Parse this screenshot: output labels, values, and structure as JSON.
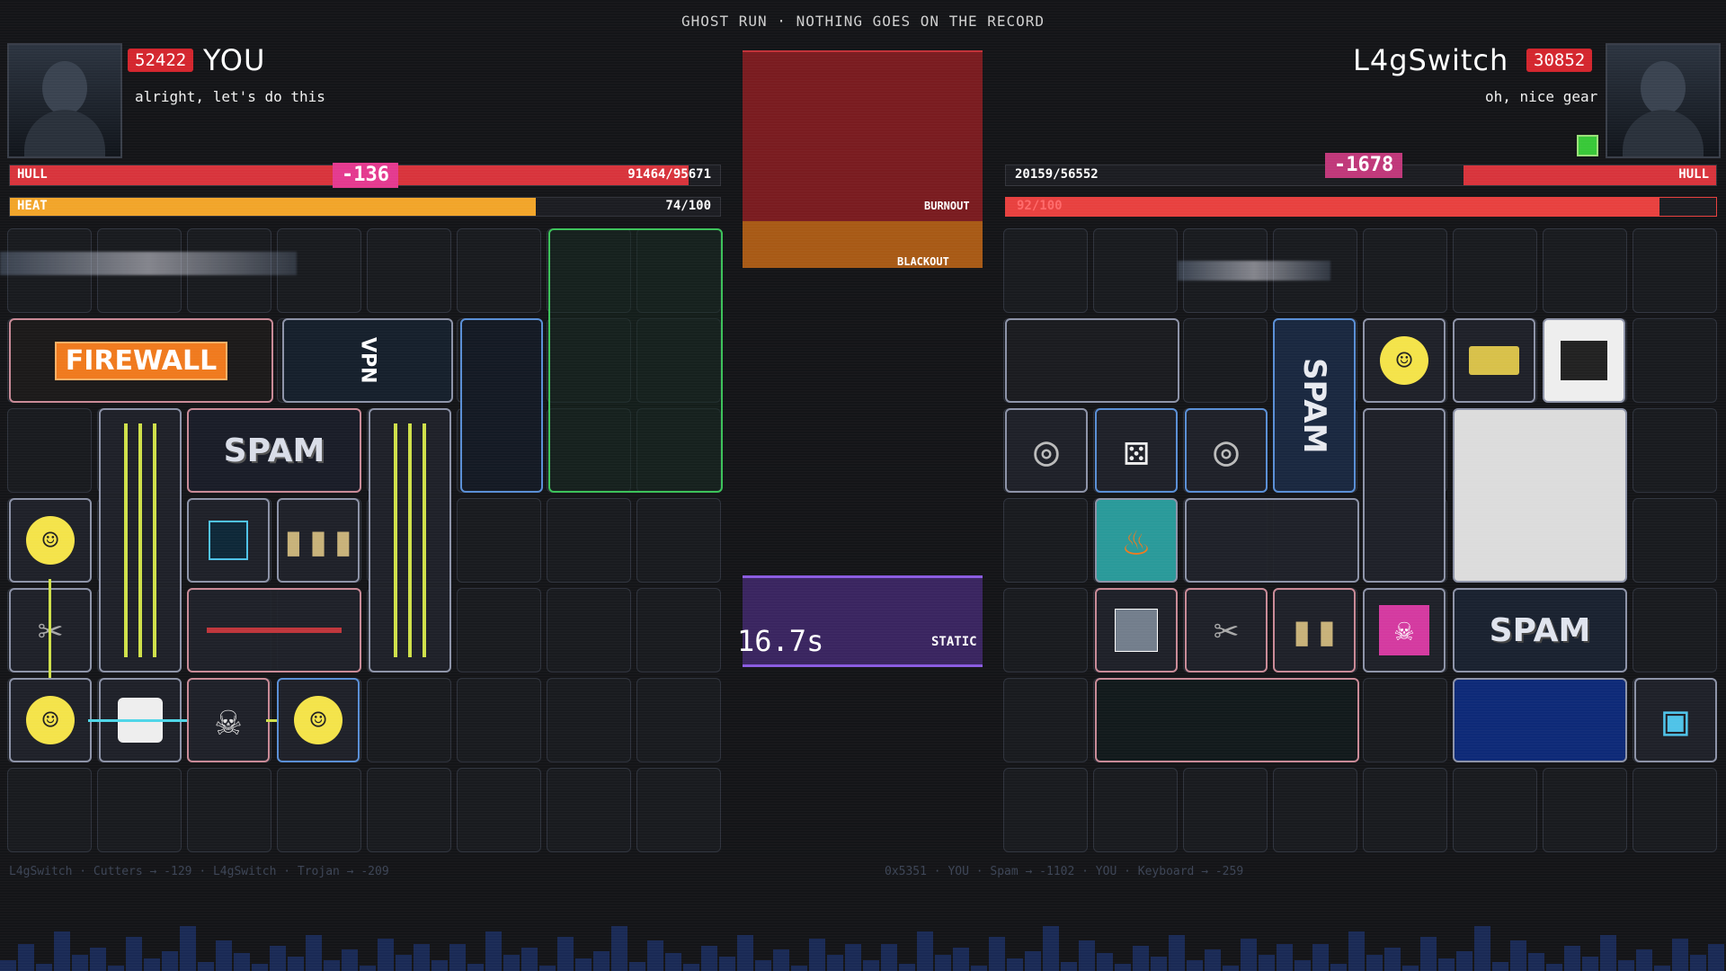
{
  "banner": "GHOST RUN · NOTHING GOES ON THE RECORD",
  "player": {
    "score": "52422",
    "name": "YOU",
    "chat": "alright, let's do this",
    "hull_label": "HULL",
    "hull_value": "91464/95671",
    "hull_fraction": 0.956,
    "damage": "-136",
    "heat_label": "HEAT",
    "heat_value": "74/100",
    "heat_fraction": 0.74
  },
  "opponent": {
    "score": "30852",
    "name": "L4gSwitch",
    "chat": "oh, nice gear",
    "hull_label": "HULL",
    "hull_value": "20159/56552",
    "hull_fraction": 0.356,
    "damage": "-1678",
    "heat_value": "92/100",
    "heat_fraction": 0.92
  },
  "center": {
    "burnout_label": "BURNOUT",
    "blackout_label": "BLACKOUT",
    "timer": "16.7s",
    "status": "STATIC"
  },
  "player_items": {
    "firewall": "FIREWALL",
    "vpn": "VPN",
    "spam": "SPAM"
  },
  "opponent_items": {
    "spam_vertical": "SPAM",
    "spam": "SPAM"
  },
  "icons": {
    "mug": "smiley-mug-icon",
    "skull": "skull-icon",
    "outlet": "power-outlet-icon",
    "disc": "disc-icon",
    "dice": "dice-icon",
    "flame": "flame-icon",
    "cutters": "wire-cutters-icon"
  },
  "feed": {
    "left": "L4gSwitch · Cutters → -129   ·   L4gSwitch · Trojan → -209",
    "right": "0x5351   ·   YOU · Spam → -1102   ·   YOU · Keyboard → -259"
  },
  "colors": {
    "hull": "#d8343c",
    "heat": "#f2a52a",
    "opp_heat": "#e8413f",
    "damage": "#e43a8f",
    "score_badge": "#d4262e",
    "static": "#8a5be0"
  }
}
